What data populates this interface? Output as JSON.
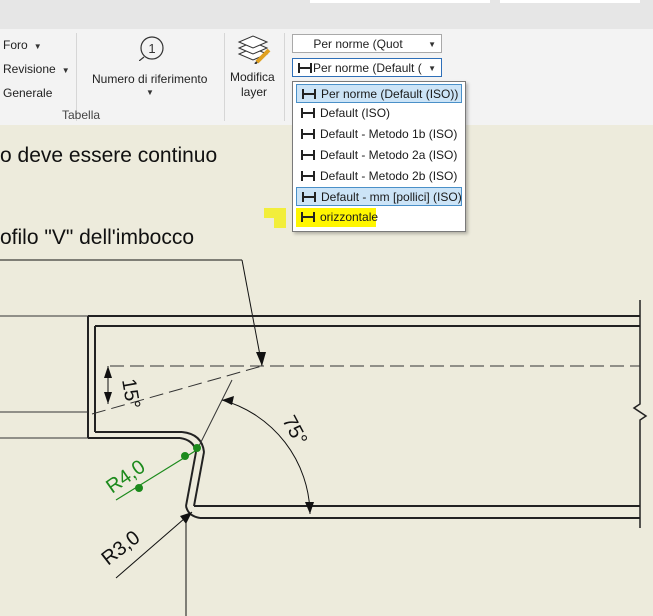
{
  "ribbon": {
    "foro": "Foro",
    "revisione": "Revisione",
    "generale": "Generale",
    "numero_riferimento": "Numero di riferimento",
    "numero_icon_glyph": "1",
    "tabella_group": "Tabella",
    "modifica_layer": [
      "Modifica",
      "layer"
    ],
    "style_combo_top": "Per norme (Quot",
    "style_combo_active": "Per norme (Default ("
  },
  "dropdown": {
    "items": [
      {
        "label": "Per norme (Default (ISO))",
        "state": "selected"
      },
      {
        "label": "Default (ISO)",
        "state": ""
      },
      {
        "label": "Default - Metodo 1b (ISO)",
        "state": ""
      },
      {
        "label": "Default - Metodo 2a (ISO)",
        "state": ""
      },
      {
        "label": "Default - Metodo 2b (ISO)",
        "state": ""
      },
      {
        "label": "Default - mm [pollici] (ISO)",
        "state": "selected"
      },
      {
        "label": "orizzontale",
        "state": "highlighted"
      }
    ]
  },
  "canvas": {
    "note_line1": "o deve essere continuo",
    "note_line2": "ofilo \"V\" dell'imbocco",
    "dim_angle_small": "15°",
    "dim_angle_large": "75°",
    "dim_radius_green": "R4,0",
    "dim_radius_black": "R3,0"
  },
  "colors": {
    "highlight": "#f2ee1e",
    "selection_blue": "#cce4f7",
    "dimension_green": "#1c8a1c",
    "paper": "#edebdc"
  }
}
